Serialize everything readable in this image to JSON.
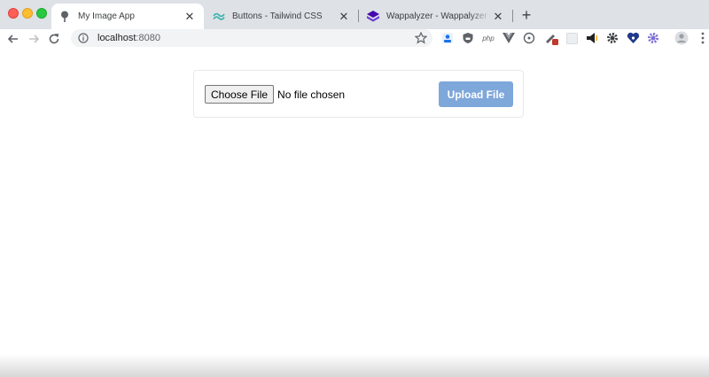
{
  "window": {
    "traffic_lights": [
      "close",
      "minimize",
      "maximize"
    ]
  },
  "tabs": [
    {
      "title": "My Image App",
      "favicon": "tree-icon",
      "active": true
    },
    {
      "title": "Buttons - Tailwind CSS",
      "favicon": "tailwind-icon",
      "active": false
    },
    {
      "title": "Wappalyzer - Wappalyzer has be",
      "favicon": "wappalyzer-icon",
      "active": false
    }
  ],
  "toolbar": {
    "url_host": "localhost",
    "url_port": ":8080",
    "extensions": [
      "person-extension-icon",
      "shield-extension-icon",
      "php-extension-icon",
      "vue-extension-icon",
      "scope-extension-icon",
      "pen-extension-icon",
      "square-extension-icon",
      "megaphone-extension-icon",
      "gear-extension-icon",
      "heart-extension-icon",
      "gear-purple-extension-icon"
    ]
  },
  "upload_form": {
    "choose_file_label": "Choose File",
    "file_status": "No file chosen",
    "upload_button_label": "Upload File"
  },
  "colors": {
    "tabstrip": "#dee1e6",
    "upload_button": "#7ea7da",
    "card_border": "#e6e8eb"
  }
}
